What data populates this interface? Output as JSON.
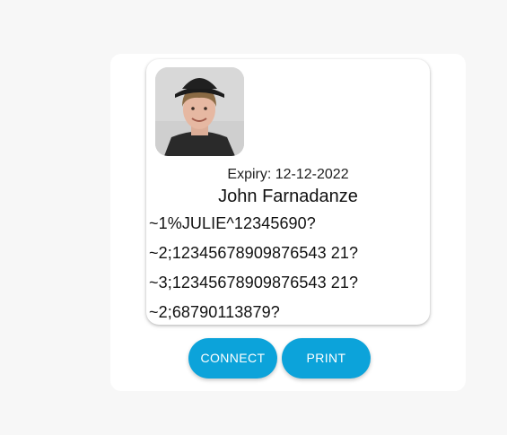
{
  "card": {
    "avatar_alt": "profile-photo",
    "expiry": "Expiry: 12-12-2022",
    "name": "John Farnadanze",
    "tracks": [
      "~1%JULIE^12345690?",
      "~2;12345678909876543 21?",
      "~3;12345678909876543 21?",
      "~2;68790113879?"
    ]
  },
  "actions": {
    "connect_label": "CONNECT",
    "print_label": "PRINT"
  },
  "colors": {
    "accent": "#0ca3da",
    "background": "#f7f7f7",
    "panel": "#ffffff"
  }
}
